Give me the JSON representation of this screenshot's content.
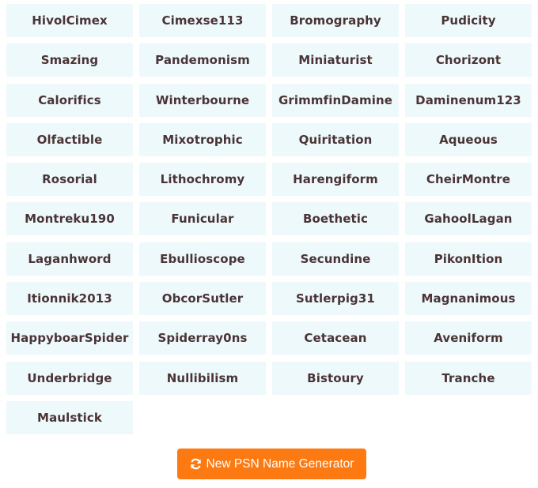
{
  "names": [
    "HivolCimex",
    "Cimexse113",
    "Bromography",
    "Pudicity",
    "Smazing",
    "Pandemonism",
    "Miniaturist",
    "Chorizont",
    "Calorifics",
    "Winterbourne",
    "GrimmfinDamine",
    "Daminenum123",
    "Olfactible",
    "Mixotrophic",
    "Quiritation",
    "Aqueous",
    "Rosorial",
    "Lithochromy",
    "Harengiform",
    "CheirMontre",
    "Montreku190",
    "Funicular",
    "Boethetic",
    "GahoolLagan",
    "Laganhword",
    "Ebullioscope",
    "Secundine",
    "PikonItion",
    "Itionnik2013",
    "ObcorSutler",
    "Sutlerpig31",
    "Magnanimous",
    "HappyboarSpider",
    "Spiderray0ns",
    "Cetacean",
    "Aveniform",
    "Underbridge",
    "Nullibilism",
    "Bistoury",
    "Tranche",
    "Maulstick"
  ],
  "generate_button": {
    "label": "New PSN Name Generator",
    "icon": "refresh-icon",
    "color": "#fd7a12"
  },
  "colors": {
    "cell_background": "#eef9fc",
    "cell_text": "#4a3435"
  }
}
